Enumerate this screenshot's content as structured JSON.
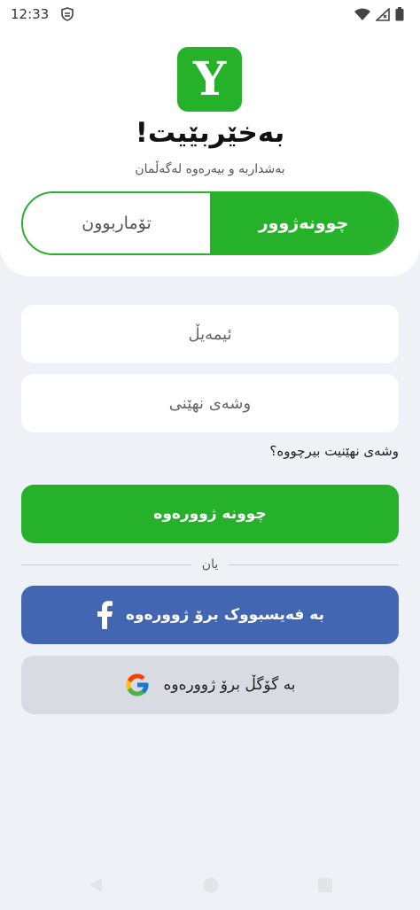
{
  "status_bar": {
    "time": "12:33"
  },
  "header": {
    "logo_letter": "Y",
    "welcome_title": "بەخێربێیت!",
    "subtitle": "بەشداربە و بیەرەوە لەگەڵمان"
  },
  "tabs": {
    "login_label": "چوونەژوور",
    "register_label": "تۆماربوون"
  },
  "form": {
    "email_placeholder": "ئیمەیڵ",
    "password_placeholder": "وشەی نهێنی",
    "forgot_label": "وشەی نهێنیت بیرچووە؟",
    "login_button": "چوونە ژوورەوە",
    "divider_text": "یان",
    "facebook_button": "بە فەیسبووک برۆ ژوورەوە",
    "google_button": "بە گۆگڵ برۆ ژوورەوە"
  },
  "colors": {
    "brand_green": "#26b12a",
    "facebook_blue": "#4266b2",
    "google_gray": "#d8dbe1",
    "background": "#eef1f6"
  },
  "icons": {
    "status": [
      "shield-icon",
      "wifi-icon",
      "signal-icon",
      "battery-icon"
    ],
    "nav": [
      "back-icon",
      "home-icon",
      "recents-icon"
    ]
  }
}
